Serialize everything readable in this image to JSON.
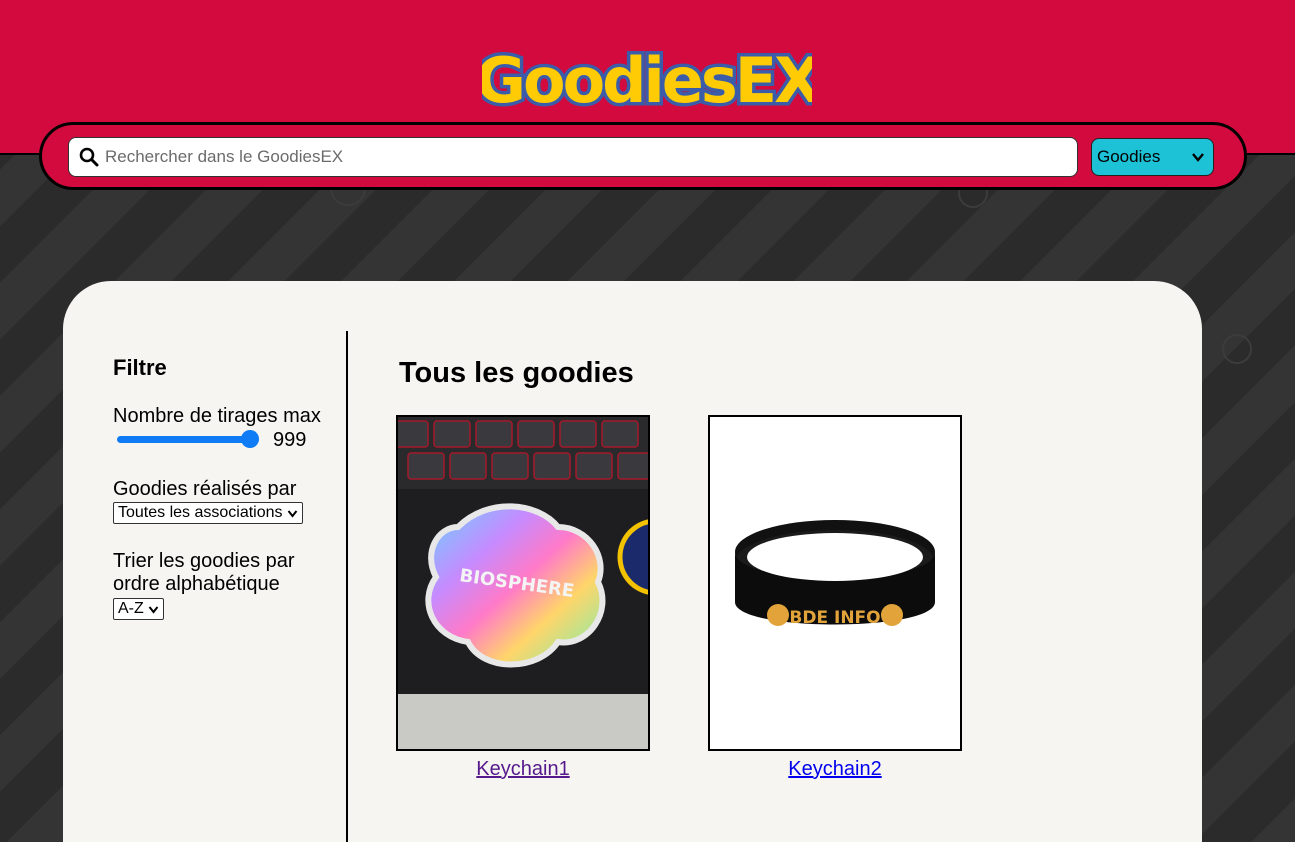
{
  "header": {
    "logo_text": "GoodiesEX"
  },
  "search": {
    "placeholder": "Rechercher dans le GoodiesEX",
    "type_selected": "Goodies"
  },
  "filters": {
    "title": "Filtre",
    "max_draws_label": "Nombre de tirages max",
    "max_draws_value": "999",
    "made_by_label": "Goodies réalisés par",
    "made_by_selected": "Toutes les associations",
    "sort_label_line1": "Trier les goodies par",
    "sort_label_line2": "ordre alphabétique",
    "sort_selected": "A-Z"
  },
  "main": {
    "title": "Tous les goodies",
    "items": [
      {
        "name": "Keychain1",
        "visited": true
      },
      {
        "name": "Keychain2",
        "visited": false
      }
    ]
  },
  "colors": {
    "header_red": "#d20a3e",
    "accent_cyan": "#1ec2d6",
    "link_blue": "#0000ee",
    "link_visited": "#551a8b",
    "slider_blue": "#0f7cf5",
    "panel_bg": "#f7f5f2"
  },
  "icons": {
    "search": "search-icon",
    "dropdown": "chevron-down-icon"
  }
}
